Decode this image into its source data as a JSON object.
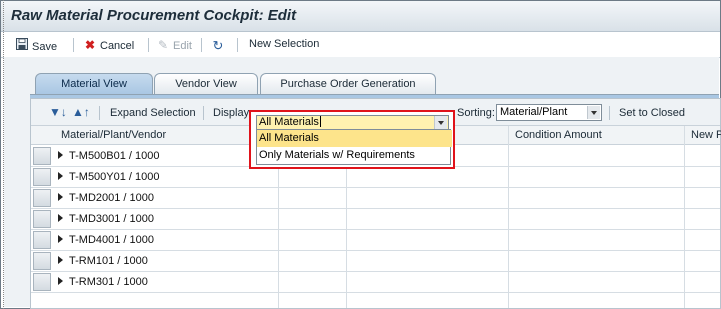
{
  "window": {
    "title": "Raw Material Procurement Cockpit: Edit"
  },
  "toolbar": {
    "save_label": "Save",
    "cancel_label": "Cancel",
    "edit_label": "Edit",
    "new_selection_label": "New Selection",
    "icons": {
      "save": "save-icon",
      "cancel": "cancel-x-icon",
      "edit": "pencil-icon",
      "refresh": "refresh-icon"
    }
  },
  "tabs": [
    {
      "label": "Material View",
      "active": true
    },
    {
      "label": "Vendor View",
      "active": false
    },
    {
      "label": "Purchase Order Generation",
      "active": false
    }
  ],
  "panel_toolbar": {
    "expand_selection_label": "Expand Selection",
    "display_label": "Display",
    "display_value": "All Materials",
    "sorting_label": "Sorting:",
    "sorting_value": "Material/Plant",
    "set_to_closed_label": "Set to Closed"
  },
  "table": {
    "columns": [
      "Material/Plant/Vendor",
      "",
      "",
      "Condition Amount",
      "New P"
    ],
    "rows": [
      "T-M500B01 / 1000",
      "T-M500Y01 / 1000",
      "T-MD2001 / 1000",
      "T-MD3001 / 1000",
      "T-MD4001 / 1000",
      "T-RM101 / 1000",
      "T-RM301 / 1000"
    ]
  },
  "dropdown": {
    "current_value": "All Materials",
    "options": [
      "All Materials",
      "Only Materials w/ Requirements"
    ],
    "highlighted_index": 0
  },
  "colors": {
    "highlight_border": "#e0131b",
    "active_tab": "#a9c7e3",
    "option_highlight": "#fde48b"
  }
}
